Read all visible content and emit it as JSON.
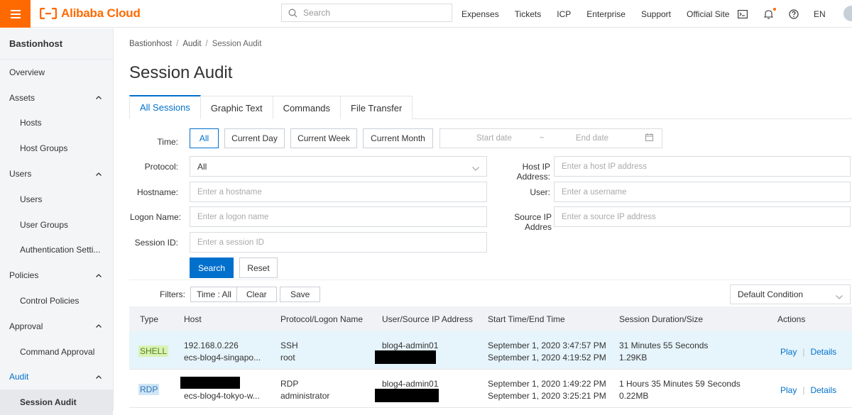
{
  "topbar": {
    "logo": "Alibaba Cloud",
    "search_placeholder": "Search",
    "nav": [
      "Expenses",
      "Tickets",
      "ICP",
      "Enterprise",
      "Support",
      "Official Site"
    ],
    "lang": "EN",
    "brand_color": "#ff6a00"
  },
  "sidebar": {
    "title": "Bastionhost",
    "items": [
      {
        "label": "Overview"
      },
      {
        "label": "Assets"
      },
      {
        "label": "Hosts"
      },
      {
        "label": "Host Groups"
      },
      {
        "label": "Users"
      },
      {
        "label": "Users"
      },
      {
        "label": "User Groups"
      },
      {
        "label": "Authentication Setti..."
      },
      {
        "label": "Policies"
      },
      {
        "label": "Control Policies"
      },
      {
        "label": "Approval"
      },
      {
        "label": "Command Approval"
      },
      {
        "label": "Audit"
      },
      {
        "label": "Session Audit"
      }
    ]
  },
  "breadcrumb": [
    "Bastionhost",
    "Audit",
    "Session Audit"
  ],
  "page_title": "Session Audit",
  "tabs": [
    "All Sessions",
    "Graphic Text",
    "Commands",
    "File Transfer"
  ],
  "form": {
    "time_label": "Time",
    "time_buttons": [
      "All",
      "Current Day",
      "Current Week",
      "Current Month"
    ],
    "start_date": "Start date",
    "end_date": "End date",
    "range_sep": "~",
    "protocol_label": "Protocol",
    "protocol_value": "All",
    "host_ip_label": "Host IP Address",
    "host_ip_placeholder": "Enter a host IP address",
    "hostname_label": "Hostname",
    "hostname_placeholder": "Enter a hostname",
    "user_label": "User",
    "user_placeholder": "Enter a username",
    "logon_label": "Logon Name",
    "logon_placeholder": "Enter a logon name",
    "source_ip_label": "Source IP Addres",
    "source_ip_placeholder": "Enter a source IP address",
    "session_label": "Session ID",
    "session_placeholder": "Enter a session ID",
    "search_btn": "Search",
    "reset_btn": "Reset",
    "colon": ":"
  },
  "filters": {
    "label": "Filters:",
    "chip": "Time : All",
    "clear": "Clear",
    "save": "Save",
    "condition": "Default Condition"
  },
  "table": {
    "headers": [
      "Type",
      "Host",
      "Protocol/Logon Name",
      "User/Source IP Address",
      "Start Time/End Time",
      "Session Duration/Size",
      "Actions"
    ],
    "rows": [
      {
        "type": "SHELL",
        "host1": "192.168.0.226",
        "host2": "ecs-blog4-singapo...",
        "proto": "SSH",
        "logon": "root",
        "user": "blog4-admin01",
        "start": "September 1, 2020 3:47:57 PM",
        "end": "September 1, 2020 4:19:52 PM",
        "duration": "31 Minutes 55 Seconds",
        "size": "1.29KB",
        "play": "Play",
        "details": "Details"
      },
      {
        "type": "RDP",
        "host1": "",
        "host2": "ecs-blog4-tokyo-w...",
        "proto": "RDP",
        "logon": "administrator",
        "user": "blog4-admin01",
        "start": "September 1, 2020 1:49:22 PM",
        "end": "September 1, 2020 3:25:21 PM",
        "duration": "1 Hours 35 Minutes 59 Seconds",
        "size": "0.22MB",
        "play": "Play",
        "details": "Details"
      }
    ]
  }
}
